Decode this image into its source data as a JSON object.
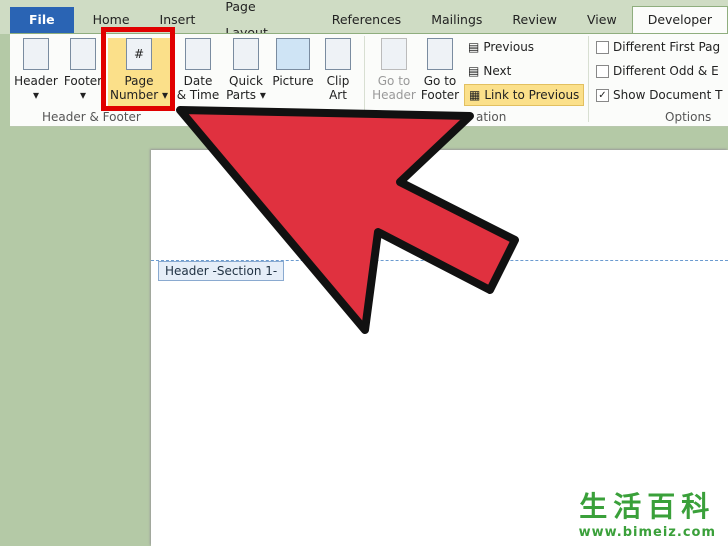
{
  "tabs": [
    "File",
    "Home",
    "Insert",
    "Page Layout",
    "References",
    "Mailings",
    "Review",
    "View",
    "Developer"
  ],
  "buttons": [
    {
      "l1": "Header",
      "l2": "▾"
    },
    {
      "l1": "Footer",
      "l2": "▾"
    },
    {
      "l1": "Page",
      "l2": "Number ▾"
    },
    {
      "l1": "Date",
      "l2": "& Time"
    },
    {
      "l1": "Quick",
      "l2": "Parts ▾"
    },
    {
      "l1": "Picture",
      "l2": ""
    },
    {
      "l1": "Clip",
      "l2": "Art"
    },
    {
      "l1": "Go to",
      "l2": "Header"
    },
    {
      "l1": "Go to",
      "l2": "Footer"
    }
  ],
  "nav": {
    "previous": "Previous",
    "next": "Next",
    "link": "Link to Previous"
  },
  "options": {
    "first": "Different First Pag",
    "odd": "Different Odd & E",
    "show": "Show Document T",
    "show_checked": true
  },
  "groups": {
    "hf": "Header & Footer",
    "nav": "ation",
    "options": "Options"
  },
  "doc": {
    "header_tag": "Header -Section 1-"
  },
  "watermark": {
    "cn": "生活百科",
    "url": "www.bimeiz.com"
  },
  "colors": {
    "highlight": "#e00000",
    "arrow": "#e0313f"
  }
}
